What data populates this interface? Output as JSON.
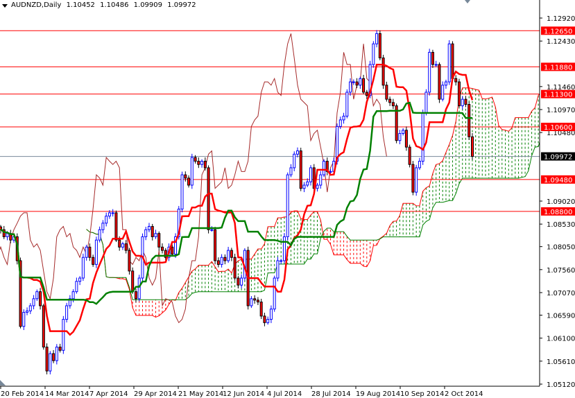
{
  "header": {
    "symbol": "AUDNZD,Daily",
    "open": "1.10452",
    "high": "1.10486",
    "low": "1.09909",
    "close": "1.09972"
  },
  "colors": {
    "bull": "#0000ff",
    "bear": "#ff0000",
    "tenkan": "#ff0000",
    "kijun": "#008000",
    "chikou": "#a52a2a",
    "cloud_up": "#008000",
    "cloud_down": "#ff0000",
    "level": "#ff0000",
    "current": "#000000"
  },
  "chart_data": {
    "type": "candlestick",
    "title": "AUDNZD,Daily",
    "indicator": "Ichimoku Kinko Hyo",
    "ylim": [
      1.0512,
      1.1335
    ],
    "x_tick_labels": [
      "20 Feb 2014",
      "14 Mar 2014",
      "7 Apr 2014",
      "29 Apr 2014",
      "21 May 2014",
      "12 Jun 2014",
      "4 Jul 2014",
      "28 Jul 2014",
      "19 Aug 2014",
      "10 Sep 2014",
      "2 Oct 2014"
    ],
    "y_tick_labels": [
      "1.12920",
      "1.12430",
      "1.11460",
      "1.10970",
      "1.10480",
      "1.09020",
      "1.08530",
      "1.08050",
      "1.07560",
      "1.07070",
      "1.06590",
      "1.06100",
      "1.05610",
      "1.05120"
    ],
    "levels": [
      "1.12650",
      "1.11880",
      "1.11300",
      "1.10600",
      "1.09480",
      "1.08800"
    ],
    "current_price": "1.09972",
    "closes": [
      1.0841,
      1.0826,
      1.0833,
      1.0819,
      1.0826,
      1.0775,
      1.0635,
      1.0665,
      1.0668,
      1.0679,
      1.0694,
      1.0709,
      1.0679,
      1.0591,
      1.054,
      1.0577,
      1.0562,
      1.0591,
      1.0584,
      1.065,
      1.0679,
      1.0694,
      1.0709,
      1.0731,
      1.0738,
      1.0782,
      1.0804,
      1.0782,
      1.0767,
      1.0819,
      1.0841,
      1.0855,
      1.087,
      1.0877,
      1.0877,
      1.0819,
      1.0804,
      1.0811,
      1.0797,
      1.0753,
      1.0709,
      1.0694,
      1.0738,
      1.0826,
      1.0841,
      1.0848,
      1.0826,
      1.0833,
      1.0804,
      1.0797,
      1.0782,
      1.0804,
      1.0789,
      1.0826,
      1.0885,
      1.0958,
      1.0951,
      1.0936,
      1.0995,
      1.0987,
      1.098,
      1.0987,
      1.0973,
      1.0841,
      1.0841,
      1.0775,
      1.0767,
      1.0782,
      1.0775,
      1.0797,
      1.0782,
      1.0738,
      1.0723,
      1.0738,
      1.0797,
      1.0679,
      1.0694,
      1.0691,
      1.0687,
      1.0657,
      1.0643,
      1.065,
      1.0672,
      1.0738,
      1.0775,
      1.0775,
      1.0826,
      1.0958,
      1.0973,
      1.1002,
      1.1009,
      1.0929,
      1.0936,
      1.0943,
      1.0973,
      1.0929,
      1.0936,
      1.0958,
      1.0987,
      1.0965,
      1.0965,
      1.0987,
      1.1061,
      1.1075,
      1.1083,
      1.1134,
      1.1156,
      1.1156,
      1.1149,
      1.1163,
      1.1134,
      1.1127,
      1.1193,
      1.1237,
      1.1259,
      1.1207,
      1.1149,
      1.1119,
      1.1112,
      1.1105,
      1.1031,
      1.1046,
      1.1053,
      1.1017,
      1.098,
      1.0921,
      1.0973,
      1.0987,
      1.109,
      1.1134,
      1.1219,
      1.1193,
      1.1193,
      1.1119,
      1.1149,
      1.1156,
      1.1237,
      1.1163,
      1.1156,
      1.1105,
      1.1119,
      1.1108,
      1.1039,
      1.09972
    ]
  }
}
